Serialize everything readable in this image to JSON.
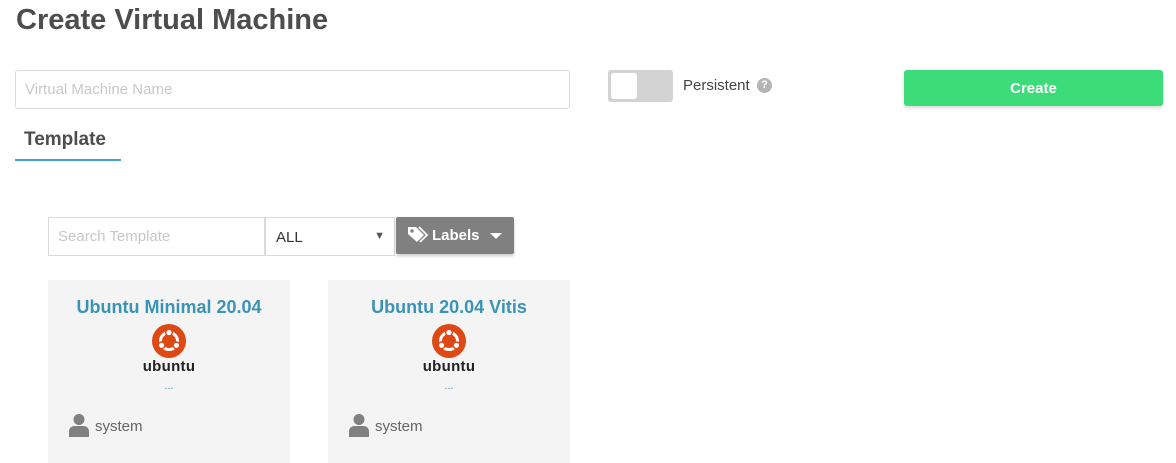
{
  "page": {
    "title": "Create Virtual Machine"
  },
  "form": {
    "name_placeholder": "Virtual Machine Name",
    "persistent_label": "Persistent",
    "help_glyph": "?",
    "create_label": "Create"
  },
  "tabs": [
    {
      "label": "Template"
    }
  ],
  "filters": {
    "search_placeholder": "Search Template",
    "select_value": "ALL",
    "select_arrow": "▼",
    "labels_button": "Labels"
  },
  "templates": [
    {
      "name": "Ubuntu Minimal 20.04",
      "logo_text": "ubuntu",
      "more": "...",
      "owner": "system"
    },
    {
      "name": "Ubuntu 20.04 Vitis",
      "logo_text": "ubuntu",
      "more": "...",
      "owner": "system"
    }
  ],
  "icons": {
    "help": "help-icon",
    "tag": "tag-icon",
    "caret": "caret-down-icon",
    "logo": "ubuntu-logo-icon",
    "user": "user-icon"
  },
  "colors": {
    "accent": "#41a7c5",
    "create_button": "#3ddc7a",
    "labels_button": "#808080",
    "ubuntu_orange": "#dd4814",
    "card_title": "#3a94b6"
  }
}
